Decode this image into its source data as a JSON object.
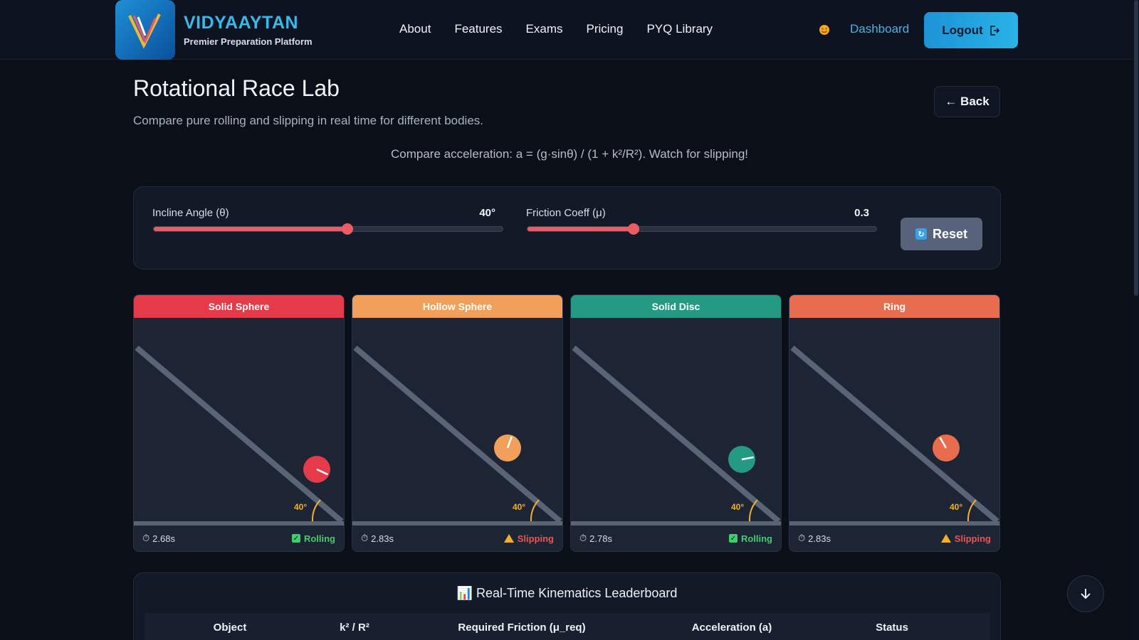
{
  "header": {
    "brand_name": "VIDYAAYTAN",
    "brand_sub": "Premier Preparation Platform",
    "nav": [
      "About",
      "Features",
      "Exams",
      "Pricing",
      "PYQ Library"
    ],
    "dashboard": "Dashboard",
    "logout": "Logout"
  },
  "page": {
    "title": "Rotational Race Lab",
    "subtitle": "Compare pure rolling and slipping in real time for different bodies.",
    "back": "← Back",
    "formula": "Compare acceleration: a = (g·sinθ) / (1 + k²/R²). Watch for slipping!"
  },
  "controls": {
    "angle_label": "Incline Angle (θ)",
    "angle_value": "40°",
    "angle_fraction": 0.556,
    "friction_label": "Friction Coeff (μ)",
    "friction_value": "0.3",
    "friction_fraction": 0.305,
    "reset": "Reset"
  },
  "cards": [
    {
      "name": "Solid Sphere",
      "color": "#e43a4a",
      "time": "2.68s",
      "status": "Rolling",
      "state": "rolling",
      "angle_label": "40°"
    },
    {
      "name": "Hollow Sphere",
      "color": "#f0a05a",
      "time": "2.83s",
      "status": "Slipping",
      "state": "slipping",
      "angle_label": "40°"
    },
    {
      "name": "Solid Disc",
      "color": "#249a84",
      "time": "2.78s",
      "status": "Rolling",
      "state": "rolling",
      "angle_label": "40°"
    },
    {
      "name": "Ring",
      "color": "#e86d4e",
      "time": "2.83s",
      "status": "Slipping",
      "state": "slipping",
      "angle_label": "40°"
    }
  ],
  "leaderboard": {
    "title": "📊 Real-Time Kinematics Leaderboard",
    "columns": [
      "Object",
      "k² / R²",
      "Required Friction (μ_req)",
      "Acceleration (a)",
      "Status"
    ]
  },
  "colors": {
    "accent": "#39b8ea",
    "slider": "#e85d65",
    "rolling": "#3ecf6a",
    "slipping": "#f0524c"
  }
}
